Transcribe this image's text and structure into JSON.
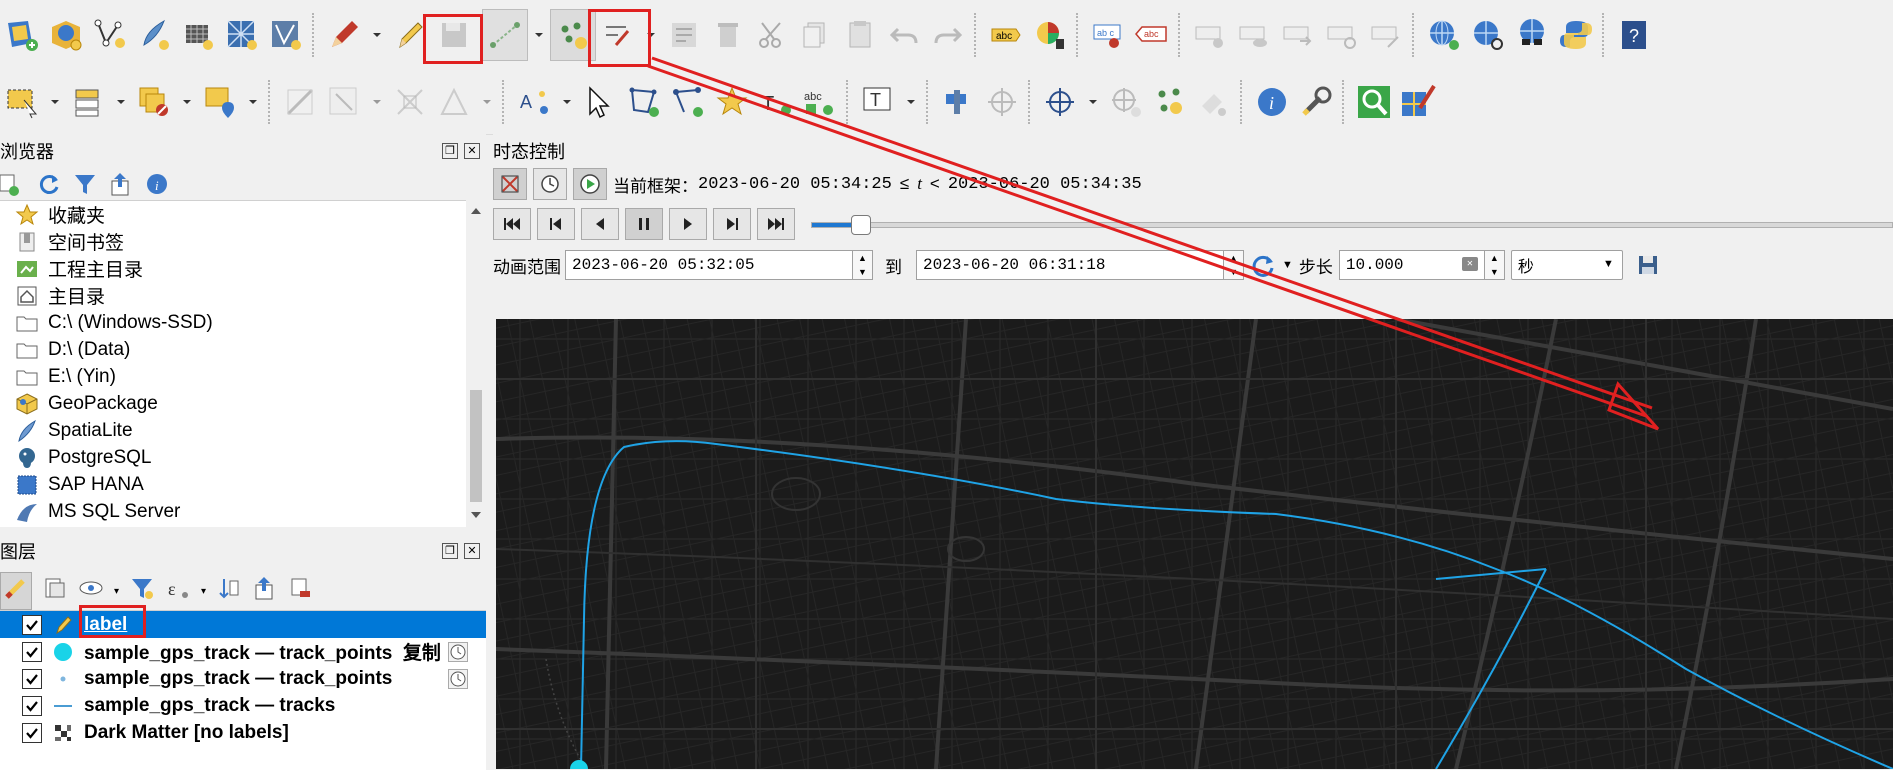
{
  "toolbar1": {
    "tools": [
      "new-map-icon",
      "open-project-icon",
      "digitize-vertex-icon",
      "pen-edit-icon",
      "grid-edit-icon",
      "mesh-icon",
      "vertex-tool-icon",
      "pencil-brush-icon",
      "edit-pencil-icon",
      "save-layer-icon",
      "add-line-icon",
      "add-points-icon",
      "split-icon",
      "table-edit-icon",
      "delete-icon",
      "cut-icon",
      "copy-icon",
      "paste-icon",
      "undo-icon",
      "redo-icon",
      "label-abc-icon",
      "pie-chart-icon",
      "label-pin-icon",
      "label-red-icon",
      "label-grey-1-icon",
      "label-grey-2-icon",
      "label-grey-3-icon",
      "label-grey-4-icon",
      "label-grey-5-icon",
      "globe-add-icon",
      "globe-search-icon",
      "globe-view-icon",
      "python-icon",
      "help-icon"
    ]
  },
  "toolbar2": {
    "tools": [
      "select-rect-icon",
      "select-attr-icon",
      "deselect-icon",
      "select-location-icon",
      "measure-icon",
      "grid-select-icon",
      "node-icon",
      "shape-icon",
      "labels-icon",
      "identify-cursor-icon",
      "add-polygon-icon",
      "add-vertex-icon",
      "star-icon",
      "text-anno-icon",
      "abc-label-icon",
      "text-t-icon",
      "pin-icon",
      "target-icon",
      "crosshair-icon",
      "grid-snap-icon",
      "sparkle-icon",
      "eraser-icon",
      "info-icon",
      "wrench-icon",
      "zoom-green-icon",
      "paint-icon"
    ]
  },
  "browser": {
    "title": "浏览器",
    "items": [
      {
        "label": "收藏夹",
        "icon": "star-icon"
      },
      {
        "label": "空间书签",
        "icon": "bookmark-icon"
      },
      {
        "label": "工程主目录",
        "icon": "project-home-icon"
      },
      {
        "label": "主目录",
        "icon": "home-icon"
      },
      {
        "label": "C:\\ (Windows-SSD)",
        "icon": "folder-icon"
      },
      {
        "label": "D:\\ (Data)",
        "icon": "folder-icon"
      },
      {
        "label": "E:\\ (Yin)",
        "icon": "folder-icon"
      },
      {
        "label": "GeoPackage",
        "icon": "geopackage-icon"
      },
      {
        "label": "SpatiaLite",
        "icon": "spatialite-icon"
      },
      {
        "label": "PostgreSQL",
        "icon": "postgresql-icon"
      },
      {
        "label": "SAP HANA",
        "icon": "saphana-icon"
      },
      {
        "label": "MS SQL Server",
        "icon": "mssql-icon"
      }
    ]
  },
  "layers": {
    "title": "图层",
    "rows": [
      {
        "label": "label",
        "symbol": "pencil",
        "checked": true,
        "selected": true,
        "clock": false
      },
      {
        "label": "sample_gps_track — track_points  复制",
        "symbol": "cyan-dot",
        "checked": true,
        "selected": false,
        "clock": true
      },
      {
        "label": "sample_gps_track — track_points",
        "symbol": "small-dot",
        "checked": true,
        "selected": false,
        "clock": true
      },
      {
        "label": "sample_gps_track — tracks",
        "symbol": "line",
        "checked": true,
        "selected": false,
        "clock": false
      },
      {
        "label": "Dark Matter [no labels]",
        "symbol": "raster",
        "checked": true,
        "selected": false,
        "clock": false
      }
    ]
  },
  "temporal": {
    "title": "时态控制",
    "frame_prefix": "当前框架：",
    "frame_start": "2023-06-20 05:34:25",
    "frame_op1": "≤",
    "frame_var": "t",
    "frame_op2": "<",
    "frame_end": "2023-06-20 05:34:35",
    "range_label": "动画范围",
    "range_start": "2023-06-20 05:32:05",
    "to_label": "到",
    "range_end": "2023-06-20 06:31:18",
    "step_label": "步长",
    "step_value": "10.000",
    "step_unit": "秒",
    "progress": 0.045
  },
  "colors": {
    "accent": "#0078d7",
    "highlight": "#e02020",
    "track": "#1fa3e6",
    "map_bg": "#1b1b1b"
  }
}
